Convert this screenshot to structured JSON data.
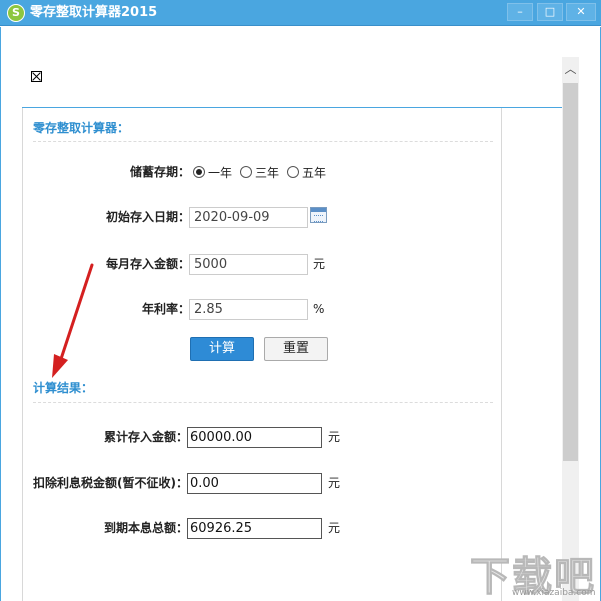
{
  "window": {
    "title": "零存整取计算器2015",
    "app_icon_glyph": "S",
    "controls": {
      "minimize": "–",
      "maximize": "□",
      "close": "✕"
    }
  },
  "scrollbar": {
    "up_glyph": "︿"
  },
  "input_section": {
    "title": "零存整取计算器：",
    "term": {
      "label": "储蓄存期：",
      "options": [
        "一年",
        "三年",
        "五年"
      ],
      "selected": "一年"
    },
    "start_date": {
      "label": "初始存入日期：",
      "value": "2020-09-09"
    },
    "monthly_deposit": {
      "label": "每月存入金额：",
      "value": "5000",
      "unit": "元"
    },
    "annual_rate": {
      "label": "年利率：",
      "value": "2.85",
      "unit": "%"
    },
    "calc_button": "计算",
    "reset_button": "重置"
  },
  "result_section": {
    "title": "计算结果：",
    "total_deposit": {
      "label": "累计存入金额：",
      "value": "60000.00",
      "unit": "元"
    },
    "tax_deducted": {
      "label": "扣除利息税金额(暂不征收)：",
      "value": "0.00",
      "unit": "元"
    },
    "maturity_total": {
      "label": "到期本息总额：",
      "value": "60926.25",
      "unit": "元"
    }
  },
  "colors": {
    "titlebar": "#4aa6e0",
    "accent": "#2f8fd0",
    "primary_button": "#2e8bd6",
    "annotation_arrow": "#d42020"
  },
  "watermark": {
    "text": "下载吧",
    "sub": "www.xiazaiba.com"
  }
}
